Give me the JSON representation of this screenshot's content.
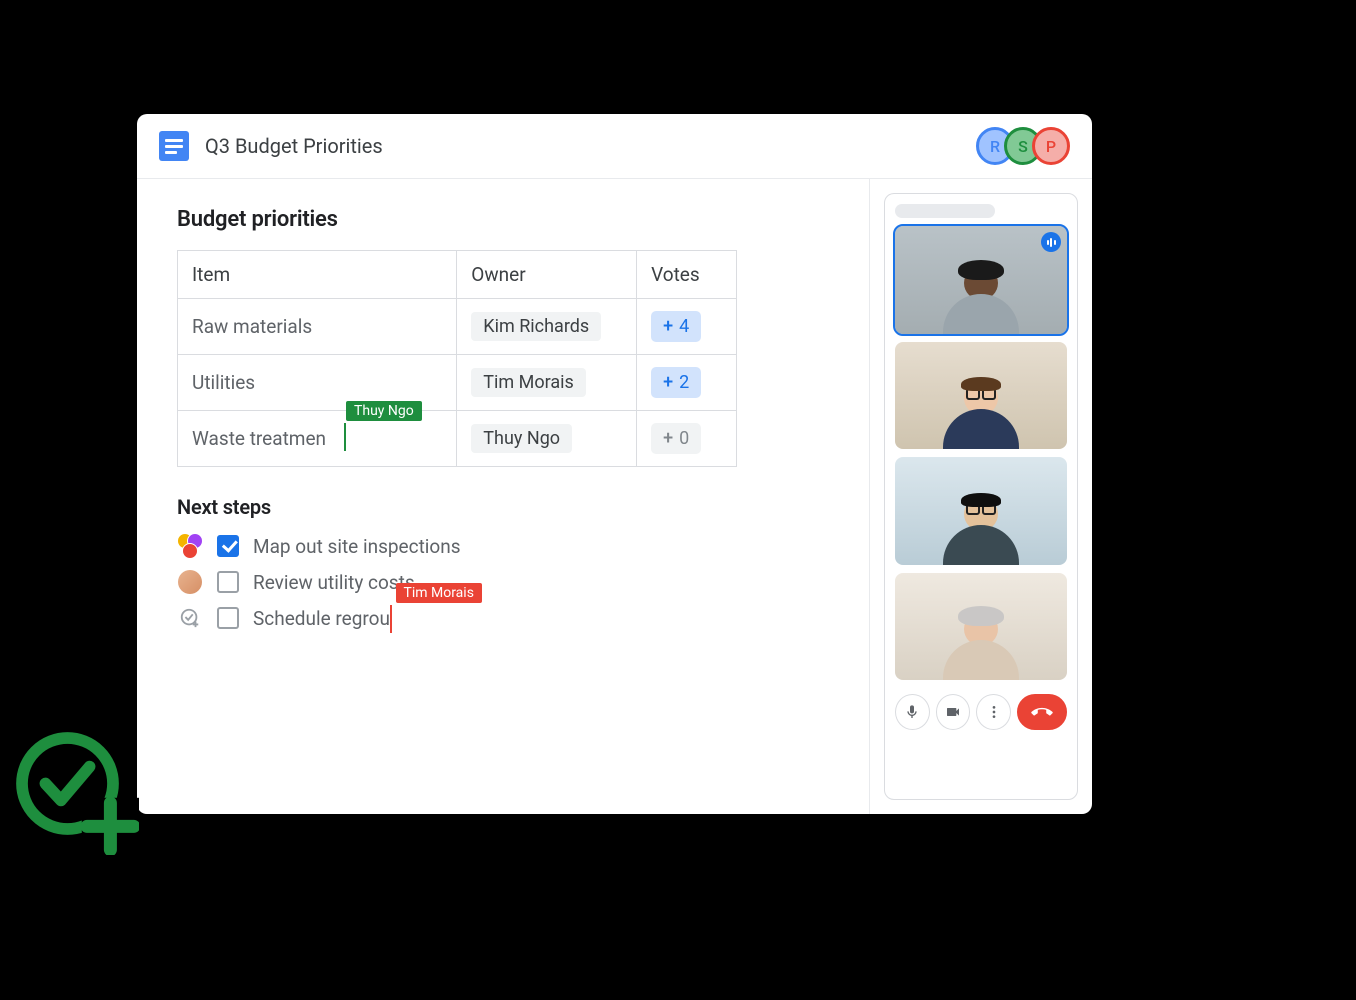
{
  "doc": {
    "title": "Q3 Budget Priorities"
  },
  "collaborators": [
    {
      "initial": "R",
      "color": "blue"
    },
    {
      "initial": "S",
      "color": "green"
    },
    {
      "initial": "P",
      "color": "red"
    }
  ],
  "section_priorities": {
    "title": "Budget priorities",
    "columns": {
      "item": "Item",
      "owner": "Owner",
      "votes": "Votes"
    },
    "rows": [
      {
        "item": "Raw materials",
        "owner": "Kim Richards",
        "votes": 4,
        "active": true
      },
      {
        "item": "Utilities",
        "owner": "Tim Morais",
        "votes": 2,
        "active": true
      },
      {
        "item": "Waste treatmen",
        "owner": "Thuy Ngo",
        "votes": 0,
        "active": false,
        "editing_cursor": "Thuy Ngo"
      }
    ]
  },
  "section_next_steps": {
    "title": "Next steps",
    "items": [
      {
        "text": "Map out site inspections",
        "checked": true,
        "assignee": "multi"
      },
      {
        "text": "Review utility costs",
        "checked": false,
        "assignee": "single"
      },
      {
        "text": "Schedule regrou",
        "checked": false,
        "assignee": "add",
        "editing_cursor": "Tim Morais"
      }
    ]
  },
  "cursors": {
    "green_user": "Thuy Ngo",
    "red_user": "Tim Morais"
  },
  "meet": {
    "participants": [
      "Participant 1",
      "Participant 2",
      "Participant 3",
      "Participant 4"
    ],
    "speaking_index": 0
  }
}
